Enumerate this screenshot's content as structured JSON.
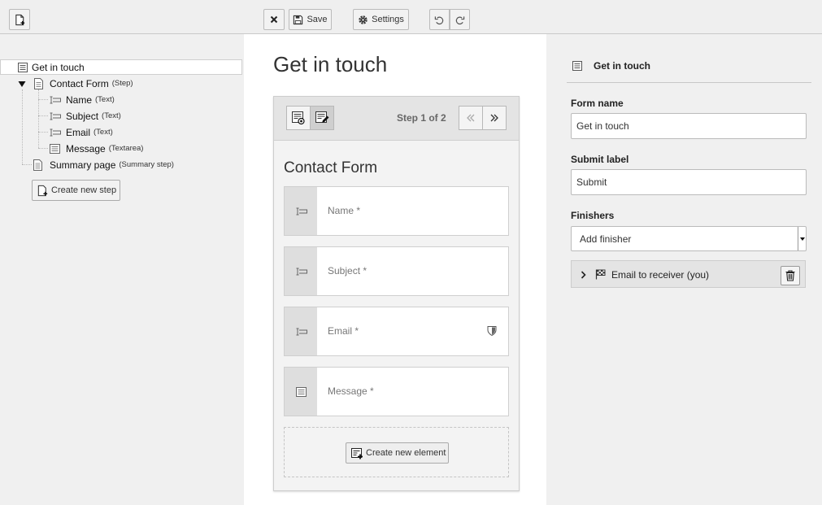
{
  "toolbar": {
    "new_form_icon": "new-document-icon",
    "close_icon": "close-icon",
    "save_label": "Save",
    "settings_label": "Settings",
    "undo_icon": "undo-icon",
    "redo_icon": "redo-icon"
  },
  "tree": {
    "root": {
      "label": "Get in touch"
    },
    "step": {
      "label": "Contact Form",
      "type": "(Step)"
    },
    "fields": [
      {
        "label": "Name",
        "type": "(Text)"
      },
      {
        "label": "Subject",
        "type": "(Text)"
      },
      {
        "label": "Email",
        "type": "(Text)"
      },
      {
        "label": "Message",
        "type": "(Textarea)"
      }
    ],
    "summary": {
      "label": "Summary page",
      "type": "(Summary step)"
    },
    "create_step_label": "Create new step"
  },
  "stage": {
    "title": "Get in touch",
    "step_indicator": "Step 1 of 2",
    "section_heading": "Contact Form",
    "fields": [
      {
        "label": "Name *",
        "icon": "text-field-icon"
      },
      {
        "label": "Subject *",
        "icon": "text-field-icon"
      },
      {
        "label": "Email *",
        "icon": "text-field-icon",
        "badge": "shield-icon"
      },
      {
        "label": "Message *",
        "icon": "textarea-icon"
      }
    ],
    "create_element_label": "Create new element"
  },
  "inspector": {
    "title": "Get in touch",
    "form_name_label": "Form name",
    "form_name_value": "Get in touch",
    "submit_label_label": "Submit label",
    "submit_label_value": "Submit",
    "finishers_label": "Finishers",
    "finisher_select_value": "Add finisher",
    "finishers": [
      {
        "label": "Email to receiver (you)"
      }
    ]
  }
}
